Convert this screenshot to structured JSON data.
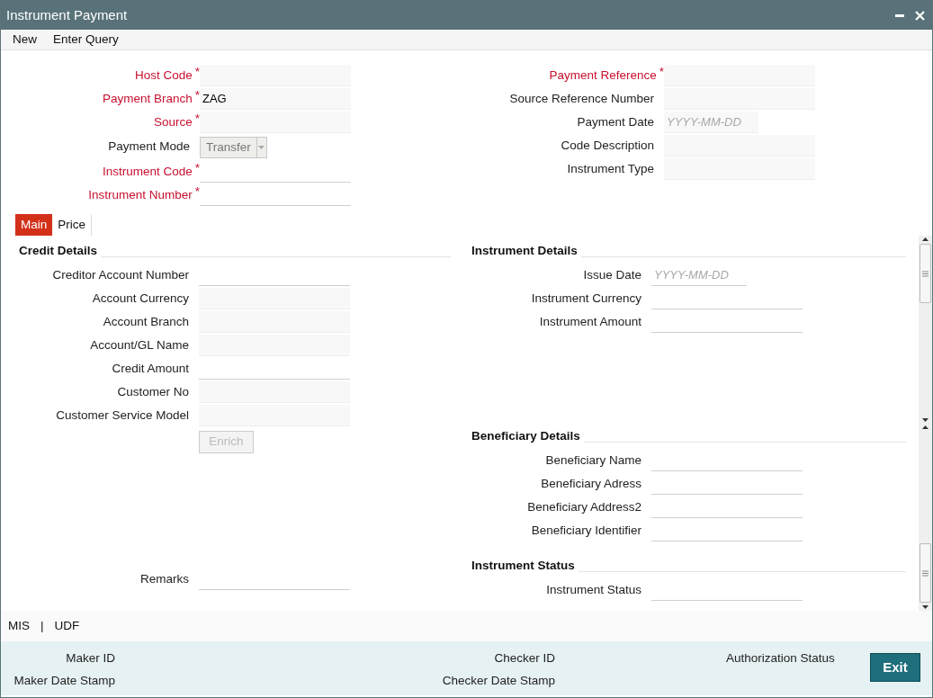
{
  "window": {
    "title": "Instrument Payment"
  },
  "menu": [
    "New",
    "Enter Query"
  ],
  "required_mark": "*",
  "header": {
    "left": [
      {
        "label": "Host Code",
        "required": true,
        "kind": "filled"
      },
      {
        "label": "Payment Branch",
        "required": true,
        "kind": "filled",
        "value": "ZAG"
      },
      {
        "label": "Source",
        "required": true,
        "kind": "filled"
      },
      {
        "label": "Payment Mode",
        "required": false,
        "kind": "select",
        "value": "Transfer"
      },
      {
        "label": "Instrument Code",
        "required": true,
        "kind": "line"
      },
      {
        "label": "Instrument Number",
        "required": true,
        "kind": "line"
      }
    ],
    "right": [
      {
        "label": "Payment Reference",
        "required": true,
        "kind": "filled"
      },
      {
        "label": "Source Reference Number",
        "required": false,
        "kind": "filled"
      },
      {
        "label": "Payment Date",
        "required": false,
        "kind": "date",
        "placeholder": "YYYY-MM-DD"
      },
      {
        "label": "Code Description",
        "required": false,
        "kind": "filled"
      },
      {
        "label": "Instrument Type",
        "required": false,
        "kind": "filled"
      }
    ]
  },
  "tabs": [
    {
      "label": "Main",
      "selected": true
    },
    {
      "label": "Price",
      "selected": false
    }
  ],
  "credit_details": {
    "title": "Credit Details",
    "fields": [
      {
        "label": "Creditor Account Number",
        "kind": "line"
      },
      {
        "label": "Account Currency",
        "kind": "filled"
      },
      {
        "label": "Account Branch",
        "kind": "filled"
      },
      {
        "label": "Account/GL Name",
        "kind": "filled"
      },
      {
        "label": "Credit Amount",
        "kind": "line"
      },
      {
        "label": "Customer No",
        "kind": "filled"
      },
      {
        "label": "Customer Service Model",
        "kind": "filled"
      }
    ],
    "button": {
      "label": "Enrich",
      "disabled": true
    },
    "remarks": {
      "label": "Remarks",
      "kind": "line"
    }
  },
  "instrument_details": {
    "title": "Instrument Details",
    "fields": [
      {
        "label": "Issue Date",
        "kind": "dateline",
        "placeholder": "YYYY-MM-DD"
      },
      {
        "label": "Instrument Currency",
        "kind": "line"
      },
      {
        "label": "Instrument Amount",
        "kind": "line"
      }
    ]
  },
  "beneficiary_details": {
    "title": "Beneficiary Details",
    "fields": [
      {
        "label": "Beneficiary Name",
        "kind": "line"
      },
      {
        "label": "Beneficiary Adress",
        "kind": "line"
      },
      {
        "label": "Beneficiary Address2",
        "kind": "line"
      },
      {
        "label": "Beneficiary Identifier",
        "kind": "line"
      }
    ]
  },
  "instrument_status": {
    "title": "Instrument Status",
    "fields": [
      {
        "label": "Instrument Status",
        "kind": "line"
      }
    ]
  },
  "links": [
    "MIS",
    "|",
    "UDF"
  ],
  "audit": [
    [
      "Maker ID",
      "Maker Date Stamp"
    ],
    [
      "Checker ID",
      "Checker Date Stamp"
    ],
    [
      "Authorization Status"
    ]
  ],
  "exit_button": "Exit"
}
